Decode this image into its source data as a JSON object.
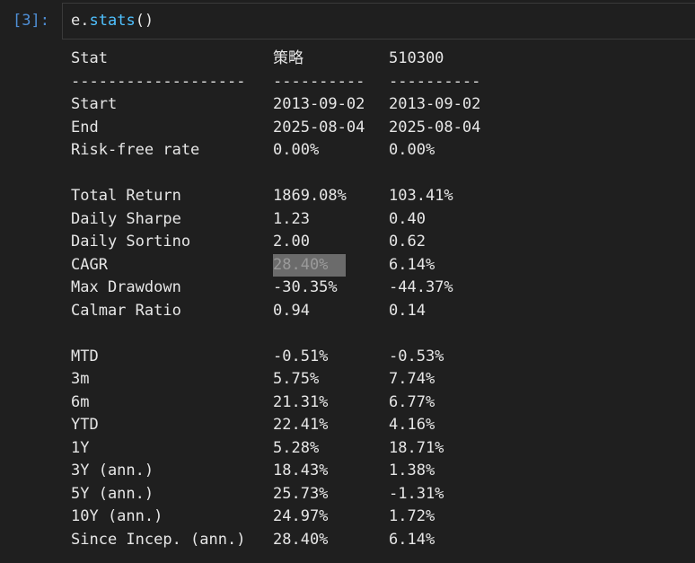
{
  "cell": {
    "prompt": "[3]:",
    "code_obj": "e",
    "code_dot": ".",
    "code_fn": "stats",
    "code_parens": "()"
  },
  "table": {
    "header": [
      "Stat",
      "策略",
      "510300"
    ],
    "separator": [
      "-------------------",
      "----------",
      "----------"
    ],
    "rows": [
      [
        "Start",
        "2013-09-02",
        "2013-09-02"
      ],
      [
        "End",
        "2025-08-04",
        "2025-08-04"
      ],
      [
        "Risk-free rate",
        "0.00%",
        "0.00%"
      ],
      [
        "",
        "",
        ""
      ],
      [
        "Total Return",
        "1869.08%",
        "103.41%"
      ],
      [
        "Daily Sharpe",
        "1.23",
        "0.40"
      ],
      [
        "Daily Sortino",
        "2.00",
        "0.62"
      ],
      [
        "CAGR",
        "28.40%",
        "6.14%"
      ],
      [
        "Max Drawdown",
        "-30.35%",
        "-44.37%"
      ],
      [
        "Calmar Ratio",
        "0.94",
        "0.14"
      ],
      [
        "",
        "",
        ""
      ],
      [
        "MTD",
        "-0.51%",
        "-0.53%"
      ],
      [
        "3m",
        "5.75%",
        "7.74%"
      ],
      [
        "6m",
        "21.31%",
        "6.77%"
      ],
      [
        "YTD",
        "22.41%",
        "4.16%"
      ],
      [
        "1Y",
        "5.28%",
        "18.71%"
      ],
      [
        "3Y (ann.)",
        "18.43%",
        "1.38%"
      ],
      [
        "5Y (ann.)",
        "25.73%",
        "-1.31%"
      ],
      [
        "10Y (ann.)",
        "24.97%",
        "1.72%"
      ],
      [
        "Since Incep. (ann.)",
        "28.40%",
        "6.14%"
      ]
    ]
  },
  "colors": {
    "background": "#1f1f1f",
    "prompt": "#4f8fd6",
    "function": "#4fc1ff",
    "text": "#e6e6e6",
    "selection": "#6b6b6b"
  }
}
